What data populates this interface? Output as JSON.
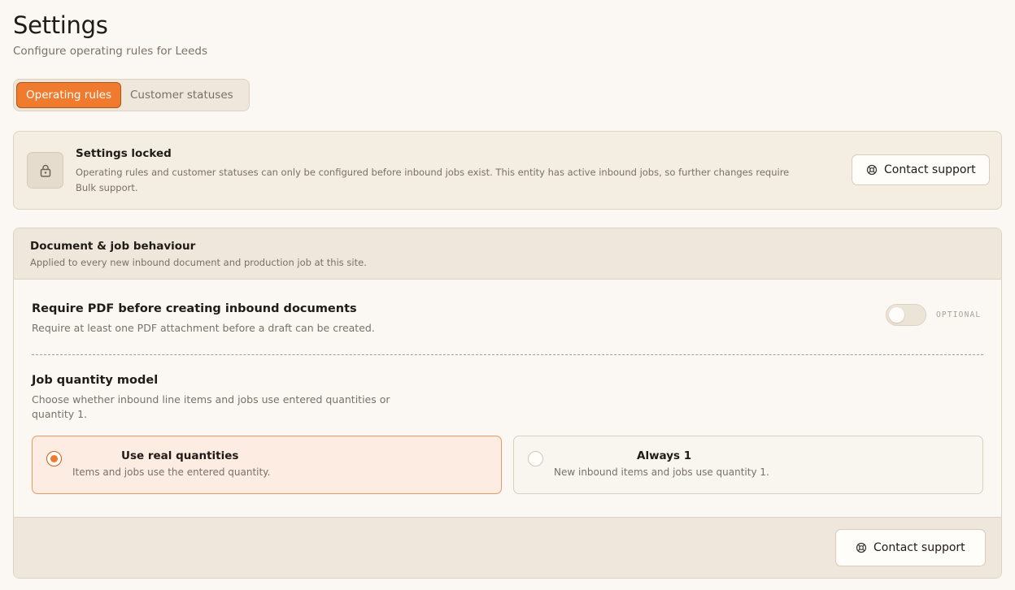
{
  "header": {
    "title": "Settings",
    "subtitle": "Configure operating rules for Leeds"
  },
  "tabs": [
    {
      "label": "Operating rules",
      "active": true
    },
    {
      "label": "Customer statuses",
      "active": false
    }
  ],
  "locked_banner": {
    "icon": "lock-icon",
    "title": "Settings locked",
    "description": "Operating rules and customer statuses can only be configured before inbound jobs exist. This entity has active inbound jobs, so further changes require Bulk support.",
    "button_label": "Contact support",
    "button_icon": "lifebuoy-icon"
  },
  "behaviour_card": {
    "title": "Document & job behaviour",
    "subtitle": "Applied to every new inbound document and production job at this site.",
    "require_pdf": {
      "title": "Require PDF before creating inbound documents",
      "description": "Require at least one PDF attachment before a draft can be created.",
      "toggle_on": false,
      "badge": "OPTIONAL"
    },
    "quantity_model": {
      "title": "Job quantity model",
      "description": "Choose whether inbound line items and jobs use entered quantities or quantity 1.",
      "options": [
        {
          "label": "Use real quantities",
          "description": "Items and jobs use the entered quantity.",
          "selected": true
        },
        {
          "label": "Always 1",
          "description": "New inbound items and jobs use quantity 1.",
          "selected": false
        }
      ]
    },
    "footer_button_label": "Contact support"
  },
  "colors": {
    "accent": "#f07a2d",
    "background": "#fbf8f3",
    "panel": "#efe7db"
  }
}
